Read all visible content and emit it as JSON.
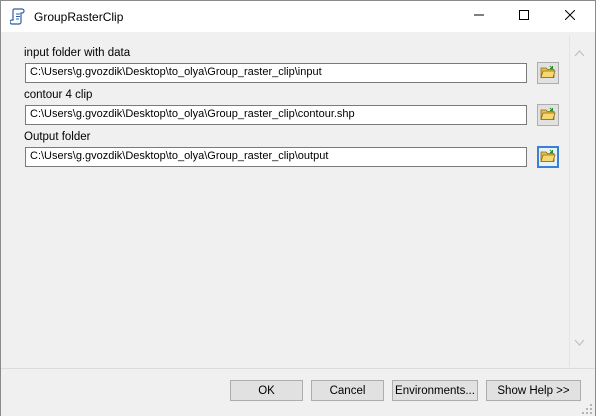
{
  "window": {
    "title": "GroupRasterClip"
  },
  "icons": {
    "app": "script-tool-icon",
    "minimize": "minimize-icon",
    "maximize": "maximize-icon",
    "close": "close-icon",
    "browse": "open-folder-icon",
    "scroll_up": "chevron-up-icon",
    "scroll_down": "chevron-down-icon"
  },
  "params": [
    {
      "label": "input folder with data",
      "value": "C:\\Users\\g.gvozdik\\Desktop\\to_olya\\Group_raster_clip\\input"
    },
    {
      "label": "contour 4 clip",
      "value": "C:\\Users\\g.gvozdik\\Desktop\\to_olya\\Group_raster_clip\\contour.shp"
    },
    {
      "label": "Output folder",
      "value": "C:\\Users\\g.gvozdik\\Desktop\\to_olya\\Group_raster_clip\\output"
    }
  ],
  "buttons": {
    "ok": "OK",
    "cancel": "Cancel",
    "environments": "Environments...",
    "show_help": "Show Help >>"
  },
  "colors": {
    "focus_border": "#3c7fd6",
    "folder_yellow": "#e8c14a"
  }
}
